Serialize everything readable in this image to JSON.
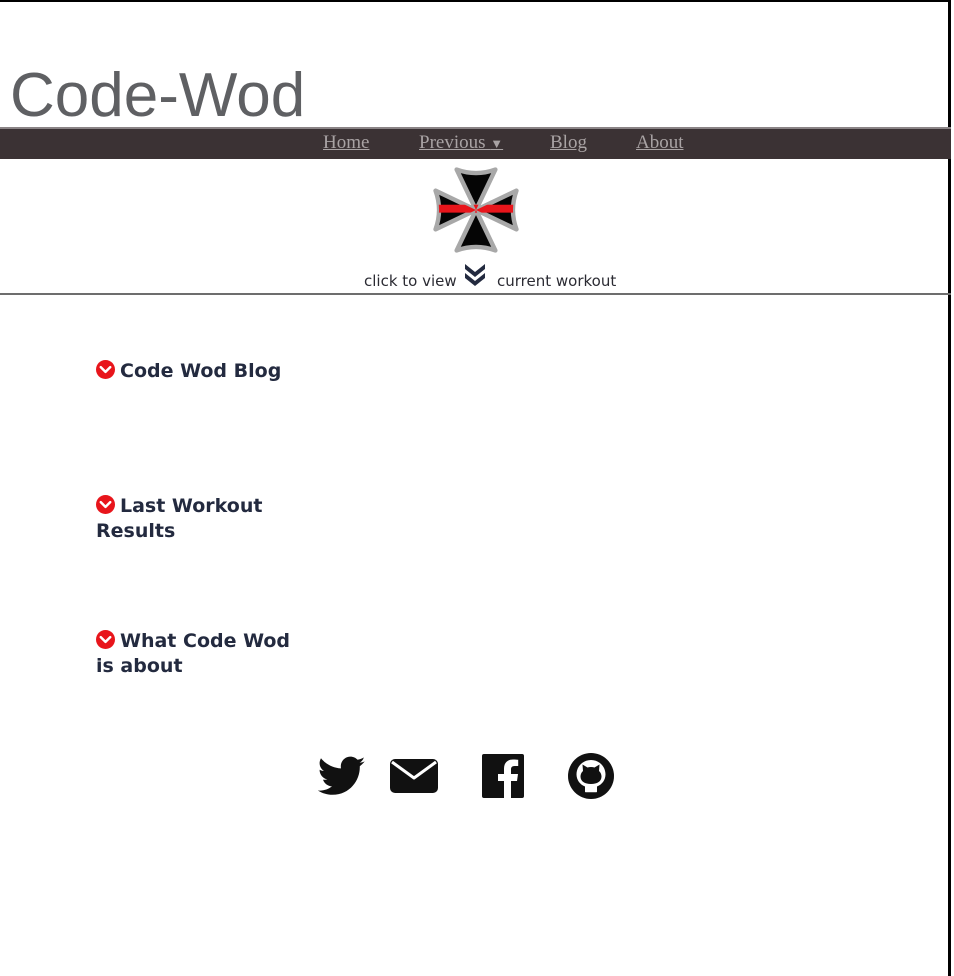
{
  "header": {
    "site_title": "Code-Wod"
  },
  "nav": {
    "items": [
      {
        "label": "Home"
      },
      {
        "label": "Previous",
        "caret": "▼"
      },
      {
        "label": "Blog"
      },
      {
        "label": "About"
      }
    ]
  },
  "hero": {
    "logo_icon": "maltese-cross-icon",
    "cta_left": "click to view",
    "cta_right": "current workout",
    "cta_icon": "double-chevron-down-icon"
  },
  "sections": [
    {
      "title": "Code Wod Blog",
      "icon": "chevron-circle-down-icon"
    },
    {
      "title": "Last Workout Results",
      "icon": "chevron-circle-down-icon"
    },
    {
      "title": "What Code Wod is about",
      "icon": "chevron-circle-down-icon"
    }
  ],
  "social": [
    {
      "icon": "twitter-icon"
    },
    {
      "icon": "envelope-icon"
    },
    {
      "icon": "facebook-icon"
    },
    {
      "icon": "github-icon"
    }
  ],
  "colors": {
    "navbar_bg": "#3b3234",
    "nav_link": "#a9a3a4",
    "accent_red": "#e8151b",
    "heading_text": "#232a3f",
    "title_text": "#5f6063"
  }
}
